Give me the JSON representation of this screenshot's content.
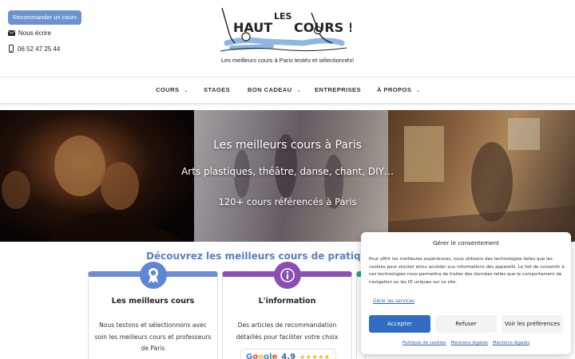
{
  "header": {
    "recommend_label": "Recommander un cours",
    "email_label": "Nous écrire",
    "phone": "06 52 47 25 44",
    "logo_text_haut": "HAUT",
    "logo_text_les": "LES",
    "logo_text_cours": "COURS !",
    "tagline": "Les meilleurs cours à Paris testés et sélectionnés!"
  },
  "nav": {
    "items": [
      {
        "label": "COURS",
        "has_dropdown": true
      },
      {
        "label": "STAGES",
        "has_dropdown": false
      },
      {
        "label": "BON CADEAU",
        "has_dropdown": true
      },
      {
        "label": "ENTREPRISES",
        "has_dropdown": false
      },
      {
        "label": "À PROPOS",
        "has_dropdown": true
      }
    ]
  },
  "hero": {
    "title": "Les meilleurs cours à Paris",
    "subtitle": "Arts plastiques, théâtre, danse, chant, DIY…",
    "count": "120+ cours référencés à Paris"
  },
  "discover": {
    "title": "Découvrez les meilleurs cours de pratiques arti",
    "cards": [
      {
        "title": "Les meilleurs cours",
        "text": "Nous testons et sélectionnons avec soin les meilleurs cours et professeurs de Paris",
        "color": "#6b8ed6",
        "icon": "award-ribbon-icon"
      },
      {
        "title": "L'information",
        "text": "Des articles de recommandation détaillés pour faciliter votre choix",
        "color": "#8d4fb7",
        "icon": "info-icon"
      }
    ],
    "google": {
      "label": "Google",
      "rating": "4,9",
      "stars": "★★★★★"
    }
  },
  "cookie": {
    "title": "Gérer le consentement",
    "text": "Pour offrir les meilleures expériences, nous utilisons des technologies telles que les cookies pour stocker et/ou accéder aux informations des appareils. Le fait de consentir à ces technologies nous permettra de traiter des données telles que le comportement de navigation ou les ID uniques sur ce site.",
    "manage_services": "Gérer les services",
    "accept": "Accepter",
    "refuse": "Refuser",
    "preferences": "Voir les préférences",
    "footer_links": [
      "Politique de cookies",
      "Mentions légales",
      "Mentions légales"
    ]
  },
  "colors": {
    "accent_blue": "#5a7ec8",
    "accept_button": "#2f6cc2",
    "card_purple": "#8d4fb7",
    "card_teal": "#2aa48f"
  }
}
